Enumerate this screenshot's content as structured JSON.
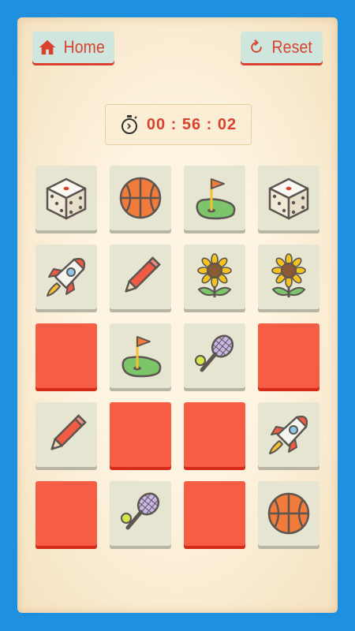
{
  "header": {
    "home_label": "Home",
    "reset_label": "Reset",
    "home_icon": "house-icon",
    "reset_icon": "refresh-icon"
  },
  "timer": {
    "icon": "stopwatch-icon",
    "value": "00 : 56 : 02"
  },
  "colors": {
    "background": "#1f8fe0",
    "panel": "#fdf4e1",
    "accent": "#d9422e",
    "card_face_up": "#e5e5d2",
    "card_face_down": "#f75d45"
  },
  "board": {
    "columns": 4,
    "rows": 5,
    "cards": [
      {
        "state": "up",
        "icon": "dice"
      },
      {
        "state": "up",
        "icon": "basketball"
      },
      {
        "state": "up",
        "icon": "golf"
      },
      {
        "state": "up",
        "icon": "dice"
      },
      {
        "state": "up",
        "icon": "rocket"
      },
      {
        "state": "up",
        "icon": "pencil"
      },
      {
        "state": "up",
        "icon": "sunflower"
      },
      {
        "state": "up",
        "icon": "sunflower"
      },
      {
        "state": "down",
        "icon": ""
      },
      {
        "state": "up",
        "icon": "golf"
      },
      {
        "state": "up",
        "icon": "tennis"
      },
      {
        "state": "down",
        "icon": ""
      },
      {
        "state": "up",
        "icon": "pencil"
      },
      {
        "state": "down",
        "icon": ""
      },
      {
        "state": "down",
        "icon": ""
      },
      {
        "state": "up",
        "icon": "rocket"
      },
      {
        "state": "down",
        "icon": ""
      },
      {
        "state": "up",
        "icon": "tennis"
      },
      {
        "state": "down",
        "icon": ""
      },
      {
        "state": "up",
        "icon": "basketball"
      }
    ]
  }
}
